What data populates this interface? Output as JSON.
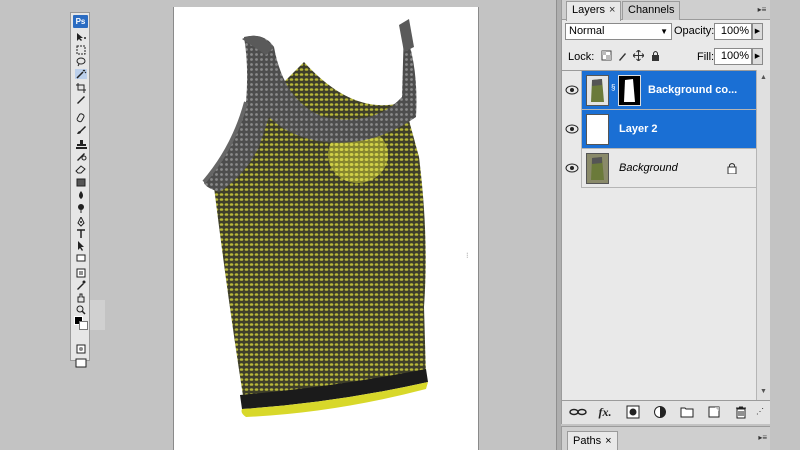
{
  "app": {
    "logo": "Ps"
  },
  "toolbox": {
    "tools": [
      "move-icon",
      "marquee-icon",
      "lasso-icon",
      "magic-wand-icon",
      "crop-icon",
      "eyedropper-icon",
      "healing-brush-icon",
      "brush-icon",
      "clone-stamp-icon",
      "history-brush-icon",
      "eraser-icon",
      "gradient-icon",
      "blur-icon",
      "dodge-icon",
      "pen-icon",
      "type-icon",
      "path-selection-icon",
      "shape-icon",
      "notes-icon",
      "eyedropper2-icon",
      "hand-icon",
      "zoom-icon"
    ],
    "foreground_color": "#000000",
    "background_color": "#ffffff"
  },
  "layers_panel": {
    "tabs": [
      {
        "label": "Layers",
        "close": "×",
        "active": true
      },
      {
        "label": "Channels",
        "active": false
      }
    ],
    "blend_mode": "Normal",
    "opacity_label": "Opacity:",
    "opacity_value": "100%",
    "lock_label": "Lock:",
    "fill_label": "Fill:",
    "fill_value": "100%",
    "layers": [
      {
        "name": "Background co...",
        "selected": true,
        "visible": true,
        "has_mask": true
      },
      {
        "name": "Layer 2",
        "selected": true,
        "visible": true,
        "has_mask": false
      },
      {
        "name": "Background",
        "selected": false,
        "visible": true,
        "locked": true
      }
    ],
    "footer_icons": [
      "link-layers-icon",
      "fx-icon",
      "add-mask-icon",
      "adjustment-layer-icon",
      "new-group-icon",
      "new-layer-icon",
      "delete-layer-icon"
    ],
    "fx_label": "fx."
  },
  "paths_panel": {
    "tab_label": "Paths",
    "close": "×"
  },
  "colors": {
    "selection": "#1a6fd4",
    "shirt_yellow": "#c8c832",
    "shirt_gray": "#5b5b5b"
  }
}
